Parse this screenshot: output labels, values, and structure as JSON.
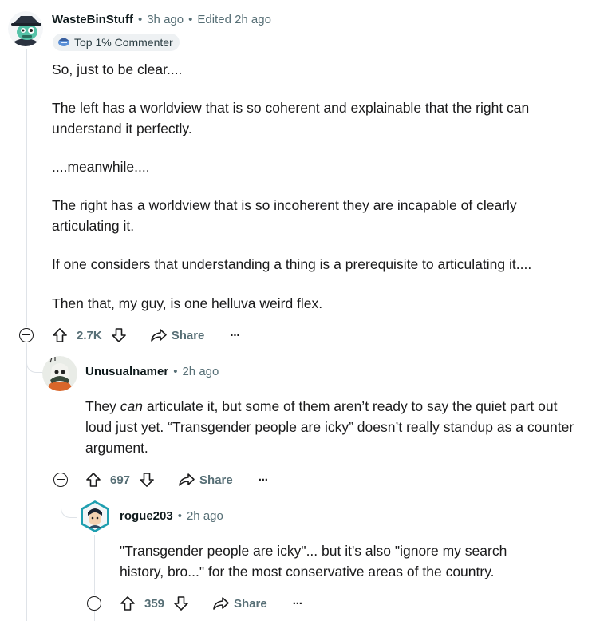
{
  "comments": [
    {
      "author": "WasteBinStuff",
      "time": "3h ago",
      "edited": "Edited 2h ago",
      "badge": "Top 1% Commenter",
      "paragraphs": [
        "So, just to be clear....",
        "The left has a worldview that is so coherent and explainable that the right can understand it perfectly.",
        "....meanwhile....",
        "The right has a worldview that is so incoherent they are incapable of clearly articulating it.",
        "If one considers that understanding a thing is a prerequisite to articulating it....",
        "Then that, my guy, is one helluva weird flex."
      ],
      "score": "2.7K",
      "share_label": "Share",
      "more_label": "···"
    },
    {
      "author": "Unusualnamer",
      "time": "2h ago",
      "paragraph_prefix": "They ",
      "paragraph_em": "can",
      "paragraph_rest": " articulate it, but some of them aren’t ready to say the quiet part out loud just yet. “Transgender people are icky” doesn’t really standup as a counter argument.",
      "score": "697",
      "share_label": "Share",
      "more_label": "···"
    },
    {
      "author": "rogue203",
      "time": "2h ago",
      "paragraph": "\"Transgender people are icky\"... but it's also \"ignore my search history, bro...\" for the most conservative areas of the country.",
      "score": "359",
      "share_label": "Share",
      "more_label": "···"
    }
  ],
  "separator": "•",
  "icons": {
    "upvote": "upvote-icon",
    "downvote": "downvote-icon",
    "share": "share-icon",
    "collapse": "collapse-icon",
    "badge": "top-commenter-icon"
  },
  "colors": {
    "meta": "#576f76",
    "text": "#1a1a1b",
    "thread_line": "#dfe3e8",
    "badge_bg": "#eef1f3"
  }
}
